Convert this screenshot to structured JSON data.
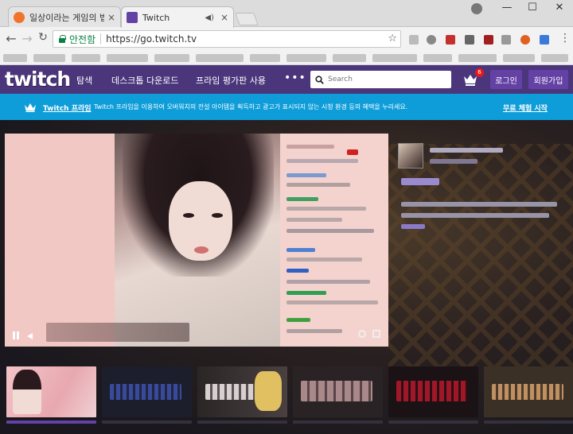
{
  "browser": {
    "tabs": [
      {
        "title": "일상이라는 게임의 법칙",
        "close": "×"
      },
      {
        "title": "Twitch",
        "close": "×"
      }
    ],
    "window_controls": {
      "minimize": "—",
      "maximize": "☐",
      "close": "✕"
    },
    "nav": {
      "back": "←",
      "forward": "→",
      "reload": "C"
    },
    "address": {
      "security_label": "안전함",
      "url": "https://go.twitch.tv"
    },
    "star": "☆",
    "menu": "⋮"
  },
  "twitch": {
    "logo": "twitch",
    "nav_links": [
      "탐색",
      "데스크톱 다운로드",
      "프라임 평가판 사용"
    ],
    "more": "•••",
    "search_placeholder": "Search",
    "notification_count": "6",
    "login_label": "로그인",
    "signup_label": "회원가입",
    "prime_banner": {
      "title": "Twitch 프라임",
      "description": "Twitch 프라임을 이용하여 오버워치의 전설 아이템을 획득하고 광고가 표시되지 않는 시청 환경 등의 혜택을 누리세요.",
      "cta": "무료 체험 시작"
    }
  },
  "colors": {
    "twitch_purple": "#4b367c",
    "button_purple": "#6441a4",
    "prime_blue": "#0e9dd9",
    "secure_green": "#0b8043",
    "badge_red": "#e91916"
  },
  "icons": {
    "tab1": "orange-favicon-icon",
    "tab2": "twitch-favicon-icon",
    "search": "search-icon",
    "crown": "crown-icon"
  }
}
